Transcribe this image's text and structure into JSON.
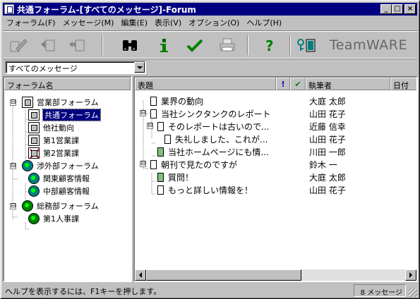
{
  "window": {
    "title": "共通フォーラム-[すべてのメッセージ]-Forum"
  },
  "menu": [
    "フォーラム(F)",
    "メッセージ(M)",
    "編集(E)",
    "表示(V)",
    "オプション(O)",
    "ヘルプ(H)"
  ],
  "toolbar": {
    "buttons": [
      "compose-icon",
      "reply-icon",
      "reply-all-icon",
      "find-icon",
      "info-icon",
      "check-icon",
      "print-icon",
      "help-icon",
      "key-icon"
    ],
    "brand": "TeamWARE"
  },
  "filter": {
    "selected": "すべてのメッセージ"
  },
  "forum_tree": {
    "header": "フォーラム名",
    "nodes": [
      {
        "label": "営業部フォーラム",
        "toggle": "⊟"
      },
      {
        "label": "共通フォーラム",
        "selected": true
      },
      {
        "label": "他社動向"
      },
      {
        "label": "第1営業課"
      },
      {
        "label": "第2営業課"
      },
      {
        "label": "渉外部フォーラム",
        "toggle": "⊟"
      },
      {
        "label": "関東顧客情報"
      },
      {
        "label": "中部顧客情報"
      },
      {
        "label": "総務部フォーラム",
        "toggle": "⊟"
      },
      {
        "label": "第1人事課"
      }
    ]
  },
  "messages": {
    "columns": {
      "subject": "表題",
      "flag": "!",
      "read": "✔",
      "author": "執筆者",
      "date": "日付"
    },
    "rows": [
      {
        "subject": "業界の動向",
        "author": "大庭 太郎"
      },
      {
        "subject": "当社シンクタンクのレポート",
        "author": "山田 花子",
        "toggle": "⊟"
      },
      {
        "subject": "そのレポートは古いので...",
        "author": "近藤 信幸",
        "toggle": "⊟"
      },
      {
        "subject": "失礼しました、これが...",
        "author": "山田 花子"
      },
      {
        "subject": "当社ホームページにも情...",
        "author": "川田 一郎"
      },
      {
        "subject": "朝刊で見たのですが",
        "author": "鈴木 一",
        "toggle": "⊟"
      },
      {
        "subject": "質問！",
        "author": "大庭 太郎"
      },
      {
        "subject": "もっと詳しい情報を！",
        "author": "山田 花子"
      }
    ]
  },
  "status": {
    "help": "ヘルプを表示するには、F1キーを押します。",
    "count": "8 メッセージ"
  }
}
